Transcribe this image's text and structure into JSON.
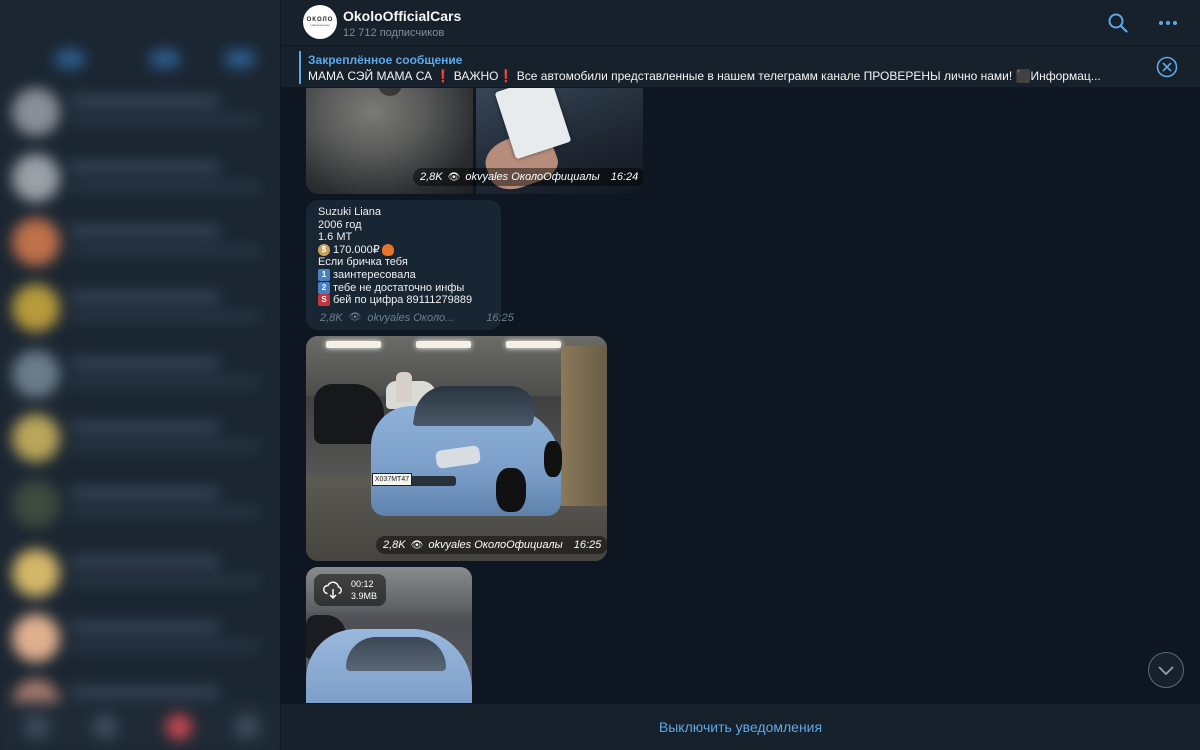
{
  "header": {
    "channel_title": "OkoloOfficialCars",
    "subscribers": "12 712 подписчиков",
    "avatar_text": "ОКОЛО",
    "avatar_subtext": "официальные"
  },
  "pinned": {
    "title": "Закреплённое сообщение",
    "text": "МАМА СЭЙ МАМА СА ❗ ВАЖНО❗ Все автомобили представленные в нашем телеграмм канале ПРОВЕРЕНЫ лично нами! ⬛Информац..."
  },
  "messages": {
    "album": {
      "views": "2,8K",
      "author": "okvyales ОколоОфициалы",
      "time": "16:24"
    },
    "text_post": {
      "lines": [
        "Suzuki Liana",
        "2006 год",
        "1.6 MT",
        "170.000₽",
        "Если бричка тебя",
        "заинтересовала",
        "тебе не достаточно инфы",
        "бей по цифра 89111279889"
      ],
      "views": "2,8K",
      "author": "okvyales Около...",
      "time": "16:25"
    },
    "car_photo": {
      "plate": "Х037МТ47",
      "views": "2,8K",
      "author": "okvyales ОколоОфициалы",
      "time": "16:25"
    },
    "video": {
      "duration": "00:12",
      "size": "3.9MB"
    }
  },
  "bottom": {
    "mute_label": "Выключить уведомления"
  },
  "colors": {
    "accent": "#5fa8e8",
    "chat_bg": "#0e1621",
    "panel_bg": "#17212b",
    "bubble_bg": "#182533"
  },
  "icons": [
    "search-icon",
    "more-icon",
    "close-icon",
    "eye-icon",
    "download-icon",
    "chevron-down-icon"
  ]
}
